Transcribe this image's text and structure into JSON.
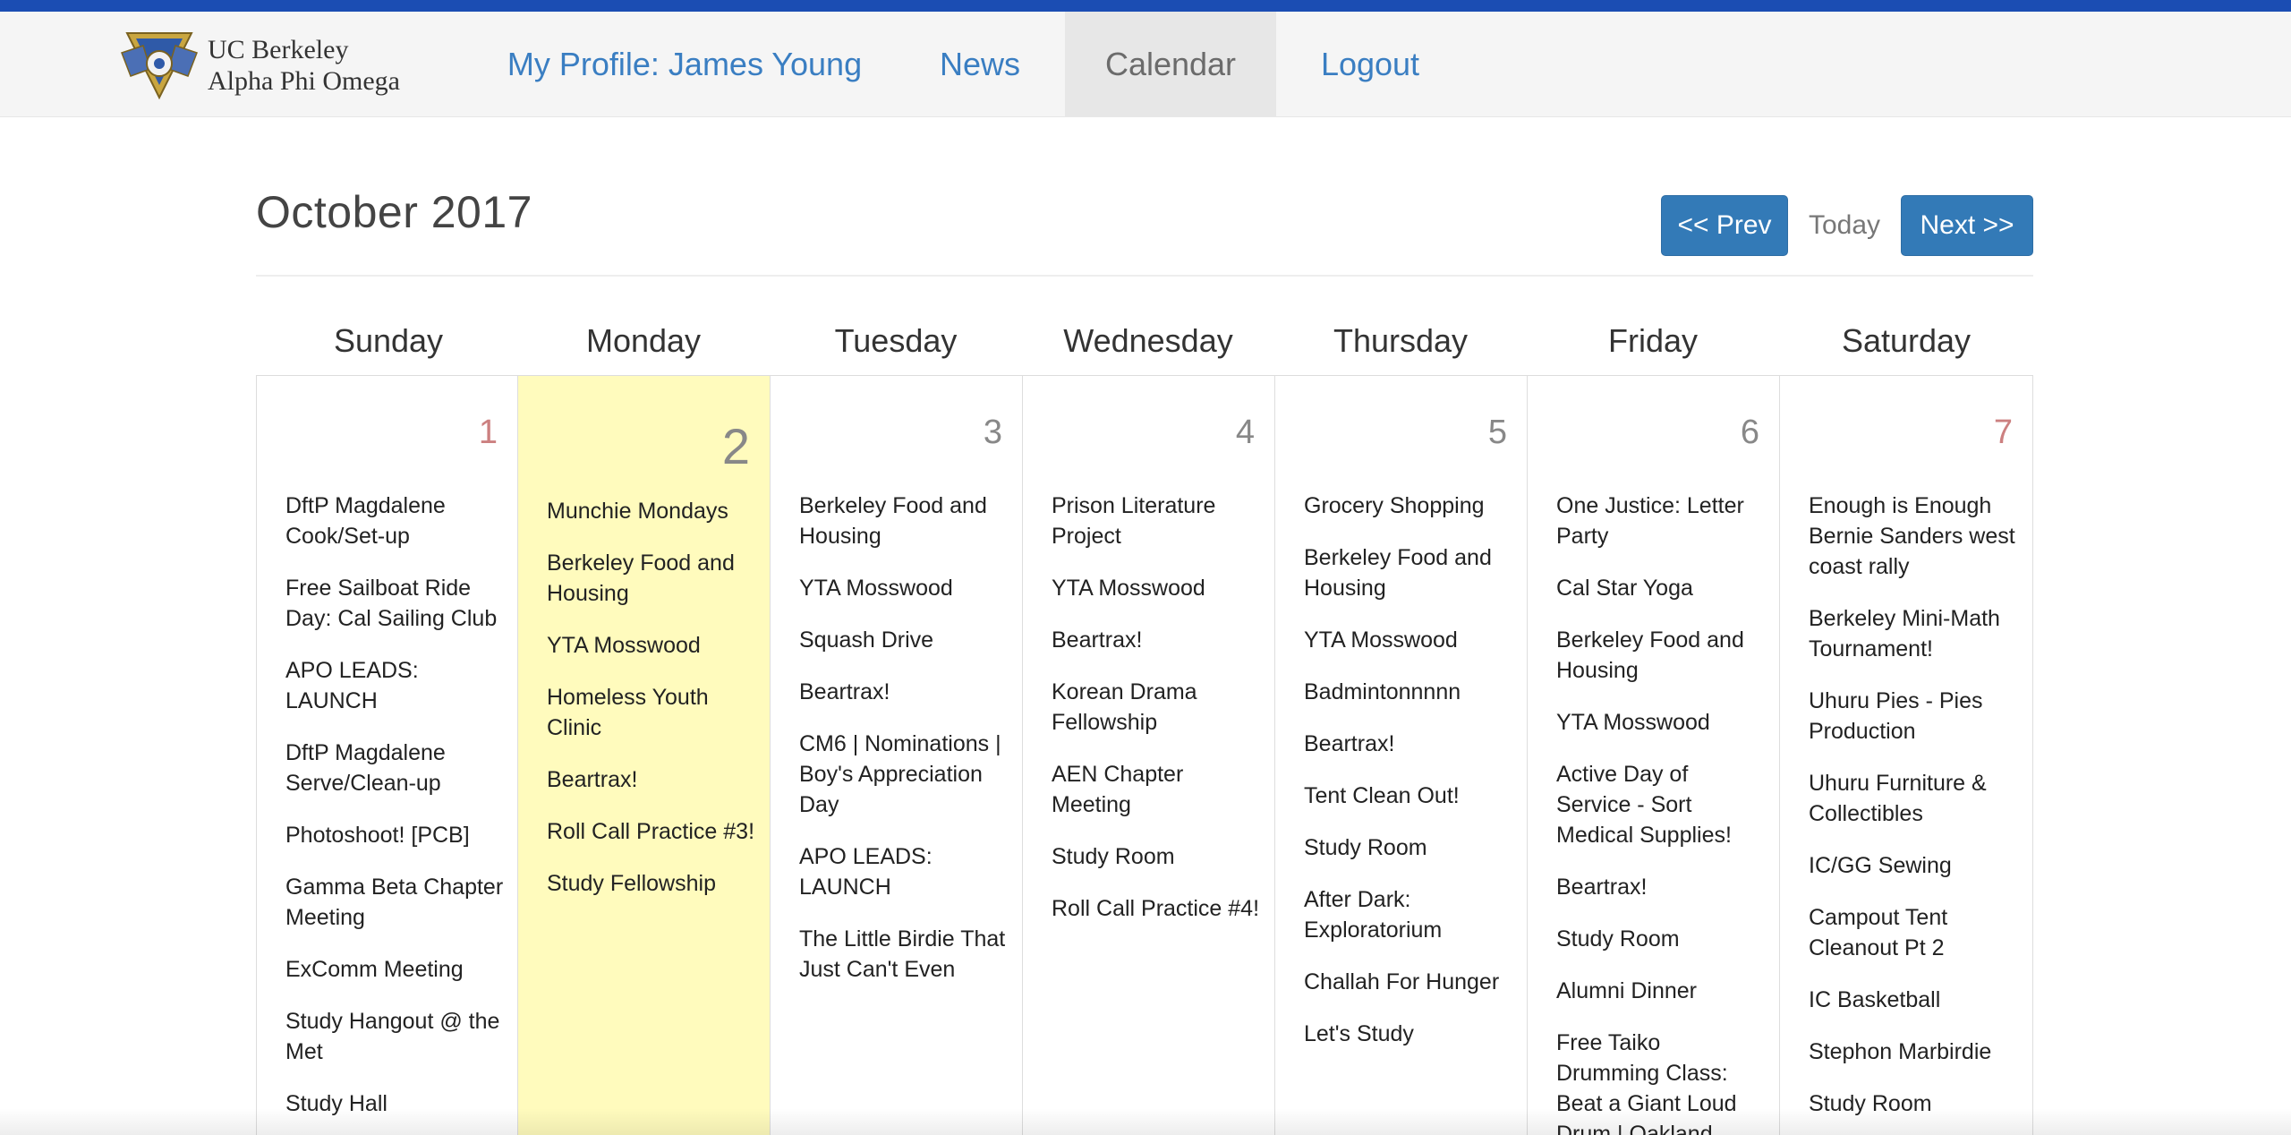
{
  "brand": {
    "line1": "UC Berkeley",
    "line2": "Alpha Phi Omega"
  },
  "nav": {
    "profile": "My Profile: James Young",
    "news": "News",
    "calendar": "Calendar",
    "logout": "Logout"
  },
  "calendar": {
    "month_title": "October 2017",
    "prev_label": "<< Prev",
    "today_label": "Today",
    "next_label": "Next >>",
    "day_names": [
      "Sunday",
      "Monday",
      "Tuesday",
      "Wednesday",
      "Thursday",
      "Friday",
      "Saturday"
    ],
    "days": [
      {
        "number": "1",
        "events": [
          "DftP Magdalene Cook/Set-up",
          "Free Sailboat Ride Day: Cal Sailing Club",
          "APO LEADS: LAUNCH",
          "DftP Magdalene Serve/Clean-up",
          "Photoshoot! [PCB]",
          "Gamma Beta Chapter Meeting",
          "ExComm Meeting",
          "Study Hangout @ the Met",
          "Study Hall"
        ]
      },
      {
        "number": "2",
        "events": [
          "Munchie Mondays",
          "Berkeley Food and Housing",
          "YTA Mosswood",
          "Homeless Youth Clinic",
          "Beartrax!",
          "Roll Call Practice #3!",
          "Study Fellowship"
        ]
      },
      {
        "number": "3",
        "events": [
          "Berkeley Food and Housing",
          "YTA Mosswood",
          "Squash Drive",
          "Beartrax!",
          "CM6 | Nominations | Boy's Appreciation Day",
          "APO LEADS: LAUNCH",
          "The Little Birdie That Just Can't Even"
        ]
      },
      {
        "number": "4",
        "events": [
          "Prison Literature Project",
          "YTA Mosswood",
          "Beartrax!",
          "Korean Drama Fellowship",
          "AEN Chapter Meeting",
          "Study Room",
          "Roll Call Practice #4!"
        ]
      },
      {
        "number": "5",
        "events": [
          "Grocery Shopping",
          "Berkeley Food and Housing",
          "YTA Mosswood",
          "Badmintonnnnn",
          "Beartrax!",
          "Tent Clean Out!",
          "Study Room",
          "After Dark: Exploratorium",
          "Challah For Hunger",
          "Let's Study"
        ]
      },
      {
        "number": "6",
        "events": [
          "One Justice: Letter Party",
          "Cal Star Yoga",
          "Berkeley Food and Housing",
          "YTA Mosswood",
          "Active Day of Service - Sort Medical Supplies!",
          "Beartrax!",
          "Study Room",
          "Alumni Dinner",
          "Free Taiko Drumming Class: Beat a Giant Loud Drum | Oakland"
        ]
      },
      {
        "number": "7",
        "events": [
          "Enough is Enough Bernie Sanders west coast rally",
          "Berkeley Mini-Math Tournament!",
          "Uhuru Pies - Pies Production",
          "Uhuru Furniture & Collectibles",
          "IC/GG Sewing",
          "Campout Tent Cleanout Pt 2",
          "IC Basketball",
          "Stephon Marbirdie",
          "Study Room"
        ]
      }
    ]
  },
  "colors": {
    "top_bar": "#1b4db3",
    "link": "#3a7ec2",
    "button": "#337ab7",
    "today_highlight": "#fffbbd",
    "weekend_number": "#cc8080"
  }
}
